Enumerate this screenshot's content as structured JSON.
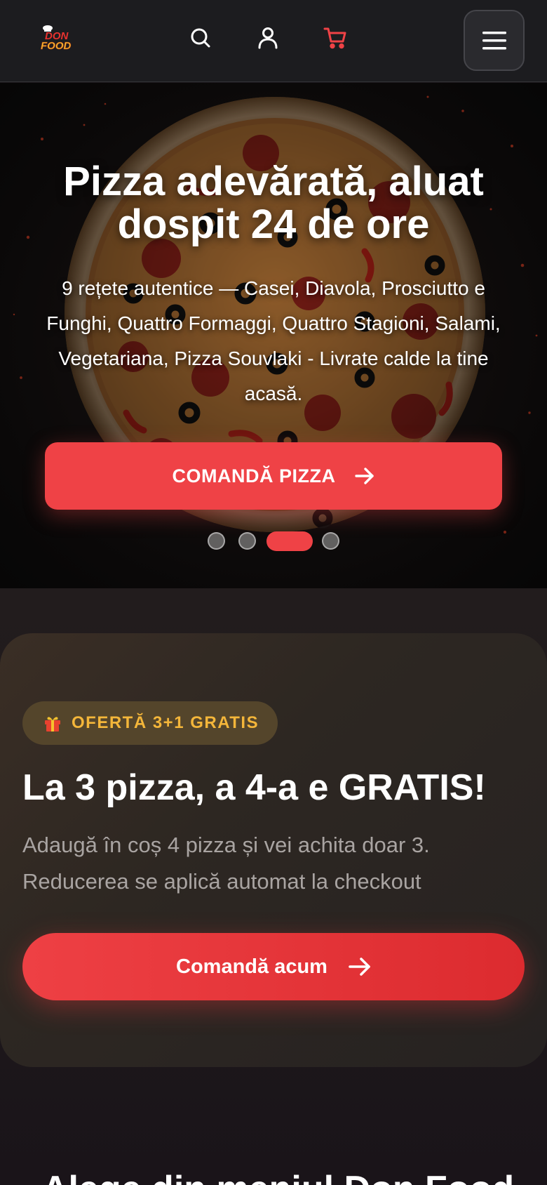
{
  "header": {
    "logo": {
      "line1": "DON",
      "line2": "FOOD"
    },
    "icons": [
      "search-icon",
      "user-icon",
      "cart-icon",
      "menu-icon"
    ],
    "accent": "#ef4246"
  },
  "hero": {
    "title": "Pizza adevărată, aluat dospit 24 de ore",
    "subtitle": "9 rețete autentice — Casei, Diavola, Prosciutto e Funghi, Quattro Formaggi, Quattro Stagioni, Salami, Vegetariana, Pizza Souvlaki - Livrate calde la tine acasă.",
    "cta_label": "COMANDĂ PIZZA",
    "carousel": {
      "total": 4,
      "active_index": 2
    }
  },
  "promo": {
    "badge_label": "OFERTĂ 3+1 GRATIS",
    "title": "La 3 pizza, a 4-a e GRATIS!",
    "description": "Adaugă în coș 4 pizza și vei achita doar 3. Reducerea se aplică automat la checkout",
    "cta_label": "Comandă acum",
    "badge_color": "#f4b63a"
  },
  "next_section": {
    "heading": "Alege din meniul Don Food"
  }
}
